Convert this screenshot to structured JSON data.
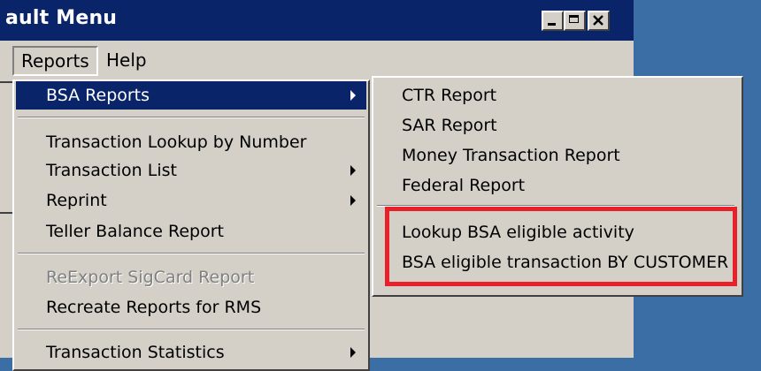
{
  "window": {
    "title": "ault Menu"
  },
  "menubar": {
    "items": [
      {
        "label": "Reports"
      },
      {
        "label": "Help"
      }
    ]
  },
  "dropdown": {
    "items": [
      {
        "label": "BSA Reports",
        "submenu": true,
        "state": "selected"
      },
      {
        "label": "Transaction Lookup by Number",
        "submenu": false,
        "state": "normal"
      },
      {
        "label": "Transaction List",
        "submenu": true,
        "state": "normal"
      },
      {
        "label": "Reprint",
        "submenu": true,
        "state": "normal"
      },
      {
        "label": "Teller Balance Report",
        "submenu": false,
        "state": "normal"
      },
      {
        "label": "ReExport SigCard Report",
        "submenu": false,
        "state": "disabled"
      },
      {
        "label": "Recreate Reports for RMS",
        "submenu": false,
        "state": "normal"
      },
      {
        "label": "Transaction Statistics",
        "submenu": true,
        "state": "normal"
      }
    ]
  },
  "submenu": {
    "items": [
      {
        "label": "CTR Report"
      },
      {
        "label": "SAR Report"
      },
      {
        "label": "Money Transaction Report"
      },
      {
        "label": "Federal Report"
      },
      {
        "label": "Lookup BSA eligible activity"
      },
      {
        "label": "BSA eligible transaction BY CUSTOMER"
      }
    ]
  },
  "colors": {
    "titlebar": "#0a246a",
    "menu_face": "#d4d0c8",
    "desktop": "#3a6ea5",
    "highlight_box": "#e8202a"
  }
}
